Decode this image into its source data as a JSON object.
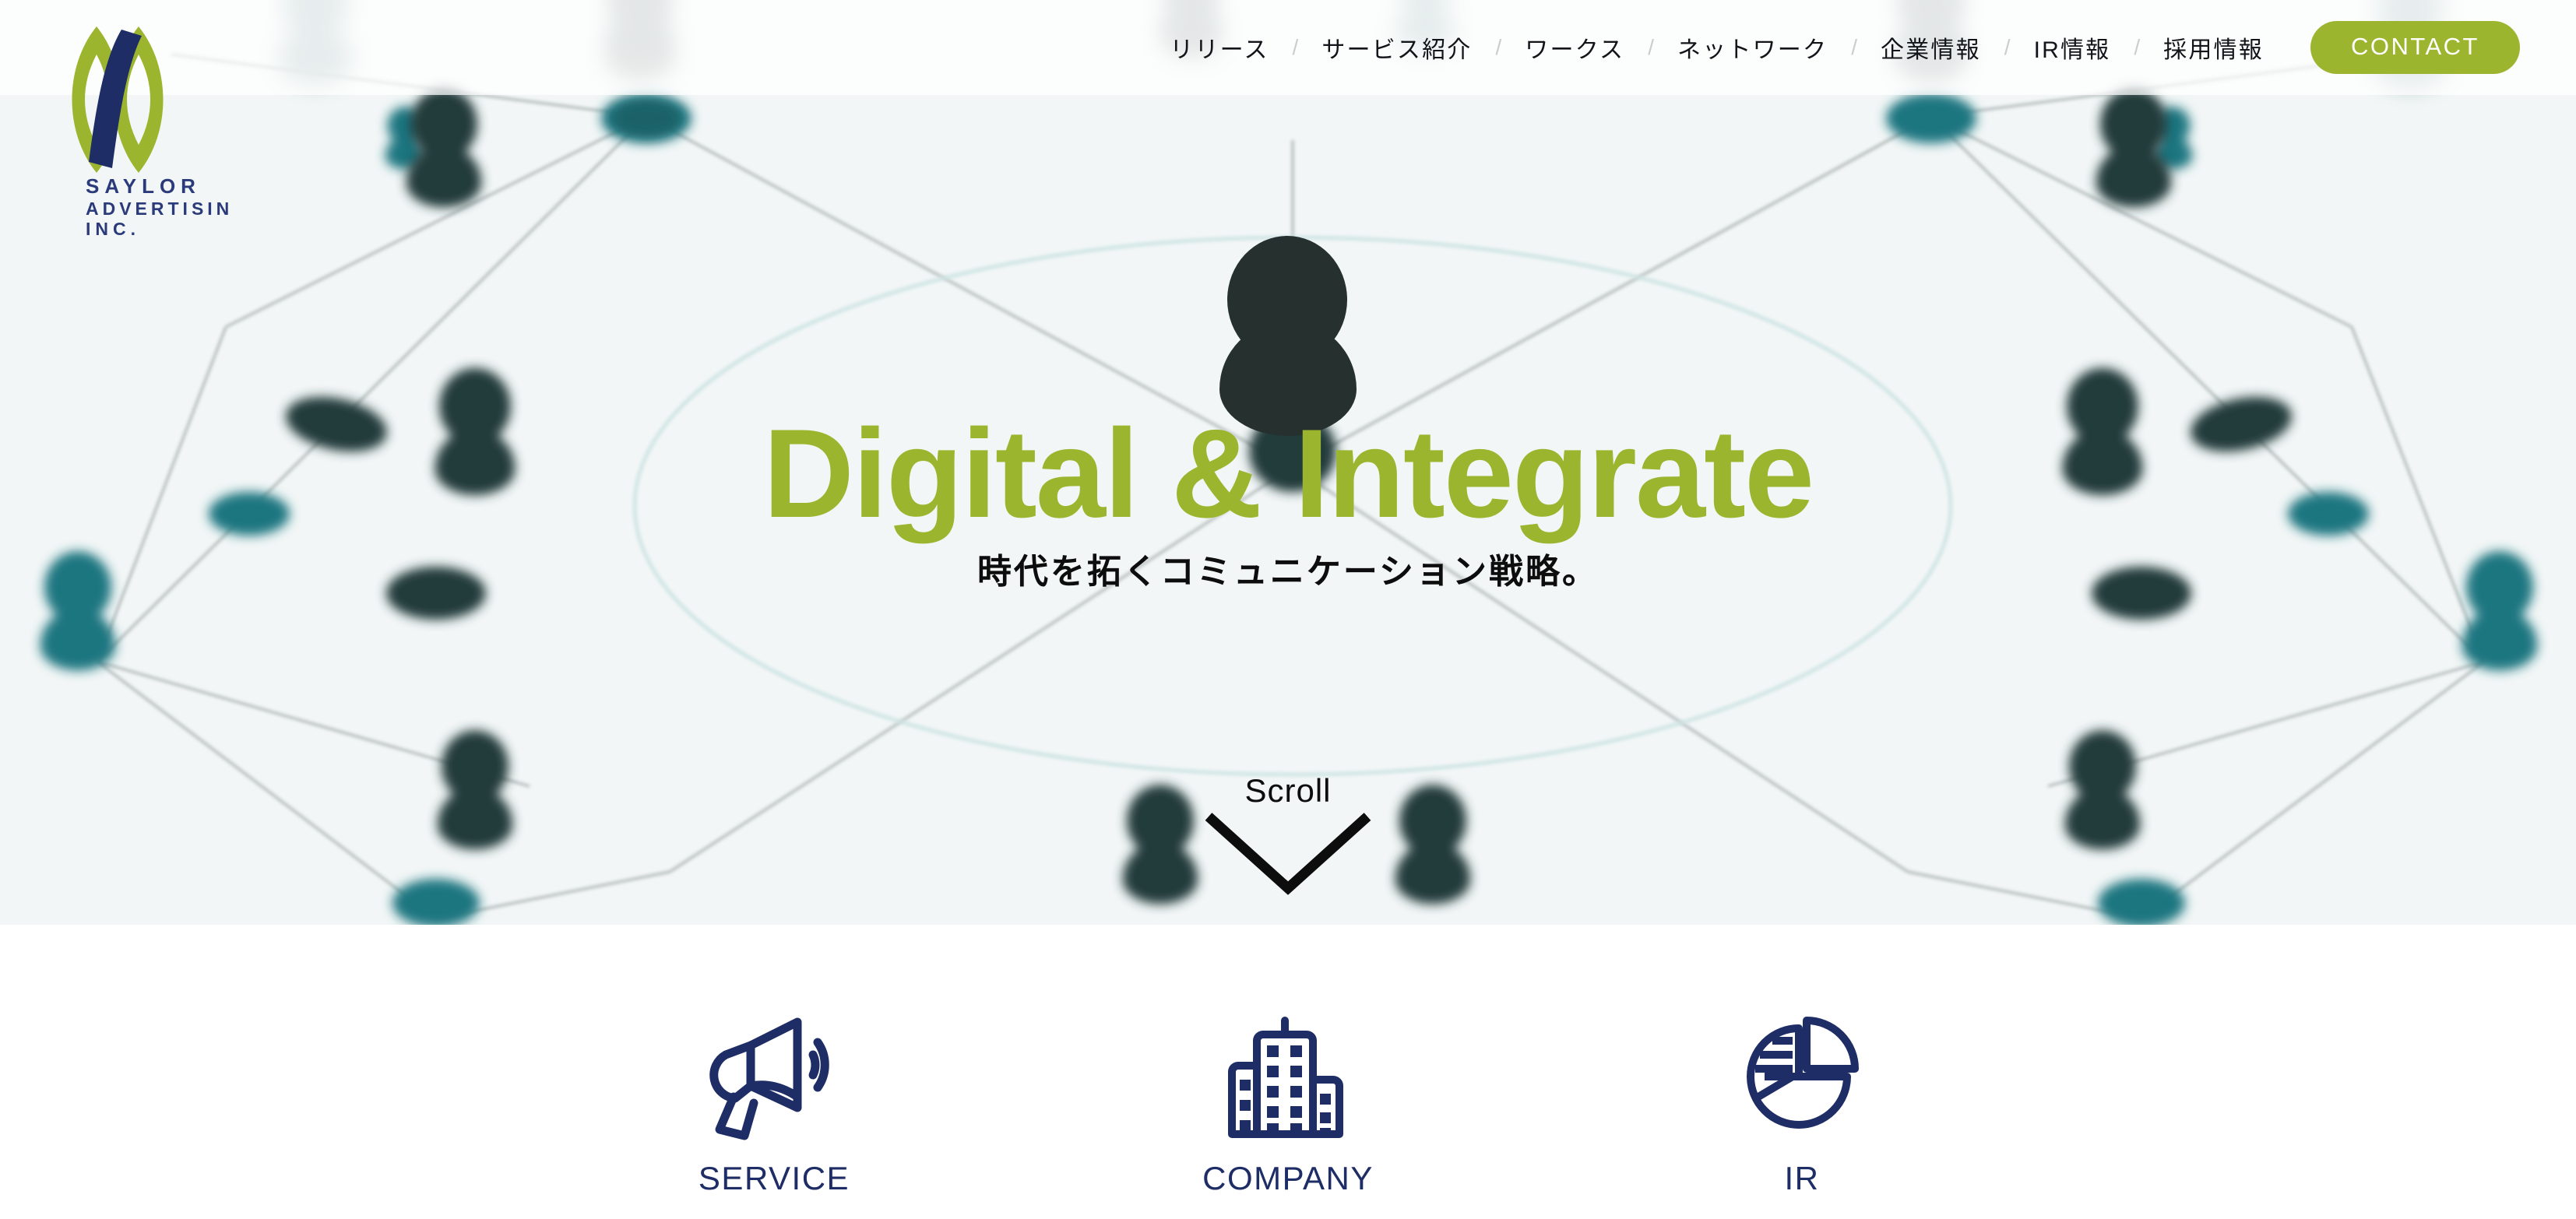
{
  "brand": {
    "name_line1": "SAYLOR",
    "name_line2": "ADVERTISING,",
    "name_line3": "INC.",
    "logo_green": "#9bb62e",
    "logo_navy": "#1e2d66"
  },
  "header": {
    "nav": [
      {
        "label": "リリース",
        "name": "release"
      },
      {
        "label": "サービス紹介",
        "name": "service"
      },
      {
        "label": "ワークス",
        "name": "works"
      },
      {
        "label": "ネットワーク",
        "name": "network"
      },
      {
        "label": "企業情報",
        "name": "company"
      },
      {
        "label": "IR情報",
        "name": "ir"
      },
      {
        "label": "採用情報",
        "name": "recruit"
      }
    ],
    "separator": "/",
    "contact_label": "CONTACT",
    "contact_color": "#9bb62e"
  },
  "hero": {
    "title": "Digital & Integrate",
    "subtitle": "時代を拓くコミュニケーション戦略。",
    "title_color": "#9bb62e",
    "background_color": "#f2f6f6",
    "scroll_label": "Scroll"
  },
  "features": [
    {
      "label": "SERVICE",
      "icon": "megaphone-icon"
    },
    {
      "label": "COMPANY",
      "icon": "buildings-icon"
    },
    {
      "label": "IR",
      "icon": "pie-chart-icon"
    }
  ],
  "colors": {
    "accent_green": "#9bb62e",
    "navy": "#1e2d66",
    "node_teal": "#1d7680",
    "node_dark": "#223b3b",
    "ring_teal": "#cfe4e4"
  }
}
